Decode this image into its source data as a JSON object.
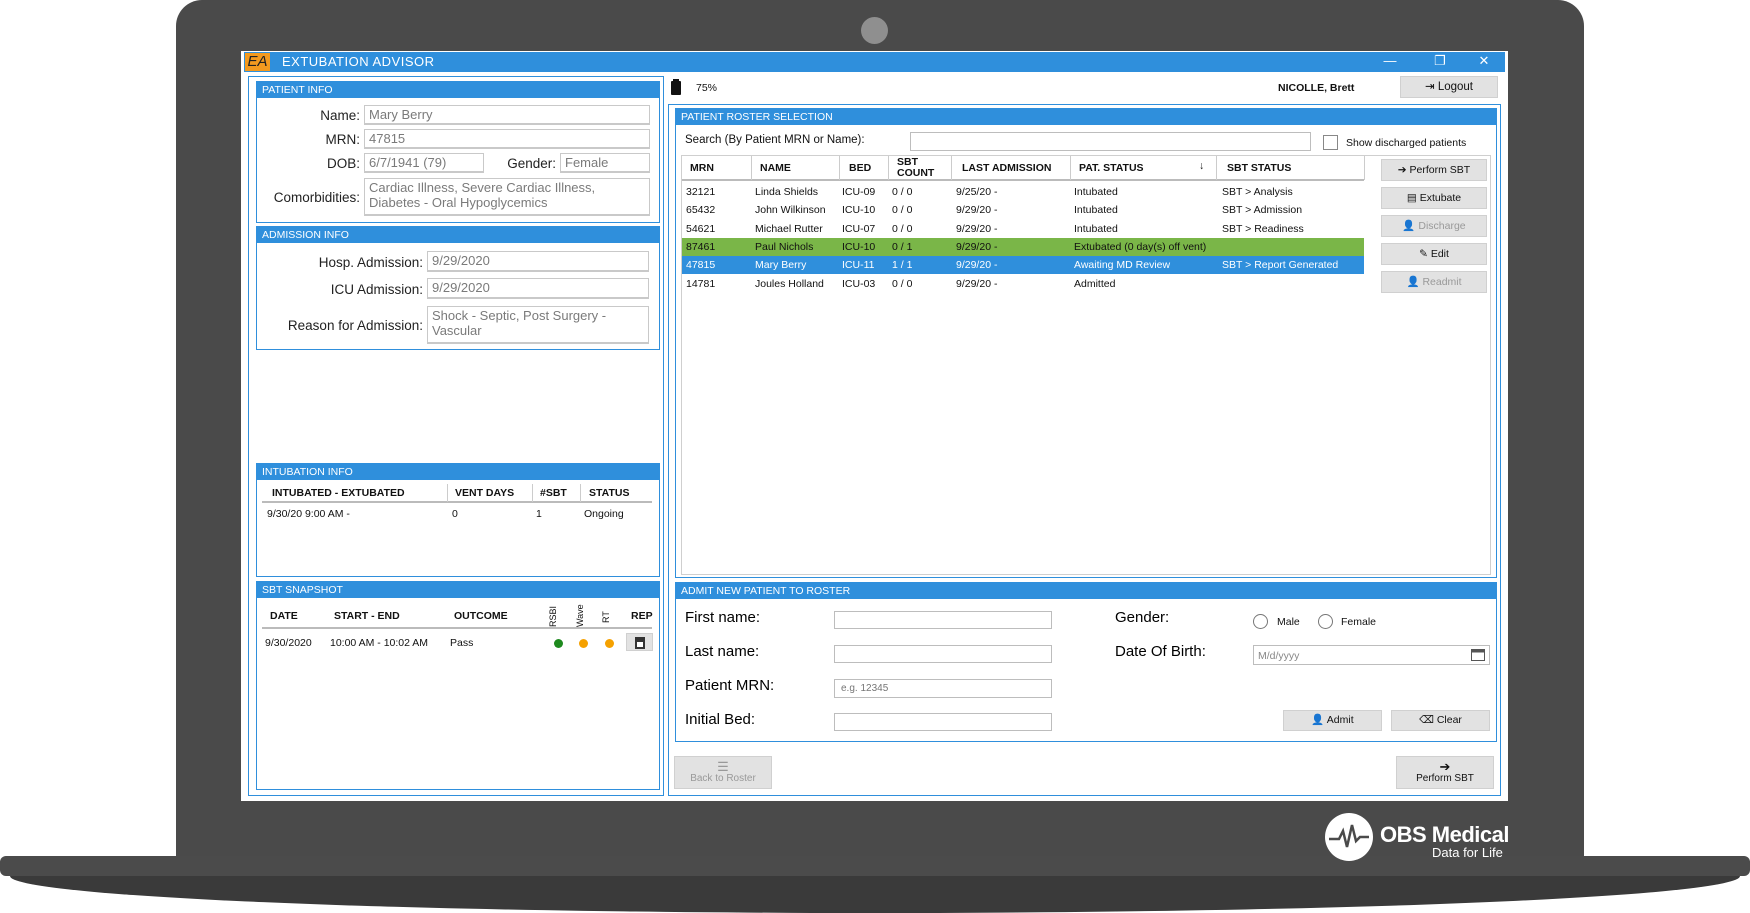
{
  "app": {
    "logo": "EA",
    "title": "EXTUBATION ADVISOR"
  },
  "window_controls": {
    "minimize": "—",
    "restore": "❐",
    "close": "✕"
  },
  "topbar": {
    "battery": "75%",
    "user": "NICOLLE, Brett",
    "logout": "Logout"
  },
  "patient_info": {
    "header": "PATIENT INFO",
    "name_label": "Name:",
    "name": "Mary Berry",
    "mrn_label": "MRN:",
    "mrn": "47815",
    "dob_label": "DOB:",
    "dob": "6/7/1941 (79)",
    "gender_label": "Gender:",
    "gender": "Female",
    "comorbidities_label": "Comorbidities:",
    "comorbidities": "Cardiac Illness, Severe Cardiac Illness, Diabetes - Oral Hypoglycemics"
  },
  "admission_info": {
    "header": "ADMISSION INFO",
    "hosp_label": "Hosp. Admission:",
    "hosp": "9/29/2020",
    "icu_label": "ICU Admission:",
    "icu": "9/29/2020",
    "reason_label": "Reason for Admission:",
    "reason": "Shock - Septic, Post Surgery - Vascular"
  },
  "intubation_info": {
    "header": "INTUBATION INFO",
    "columns": [
      "INTUBATED - EXTUBATED",
      "VENT DAYS",
      "#SBT",
      "STATUS"
    ],
    "rows": [
      {
        "period": "9/30/20 9:00 AM -",
        "vent_days": "0",
        "sbt": "1",
        "status": "Ongoing"
      }
    ]
  },
  "sbt_snapshot": {
    "header": "SBT SNAPSHOT",
    "columns": [
      "DATE",
      "START - END",
      "OUTCOME",
      "RSBI",
      "Wave",
      "RT",
      "REPORT"
    ],
    "rows": [
      {
        "date": "9/30/2020",
        "time": "10:00 AM - 10:02 AM",
        "outcome": "Pass"
      }
    ],
    "dot_colors": [
      "#1e8a1e",
      "#f5a100",
      "#f5a100"
    ]
  },
  "roster": {
    "header": "PATIENT ROSTER SELECTION",
    "search_label": "Search (By Patient MRN or Name):",
    "show_discharged": "Show discharged patients",
    "columns": [
      "MRN",
      "NAME",
      "BED",
      "SBT COUNT",
      "LAST ADMISSION",
      "PAT. STATUS",
      "SBT STATUS"
    ],
    "rows": [
      {
        "mrn": "32121",
        "name": "Linda Shields",
        "bed": "ICU-09",
        "sbt": "0 / 0",
        "admission": "9/25/20 -",
        "status": "Intubated",
        "sbt_status": "SBT > Analysis"
      },
      {
        "mrn": "65432",
        "name": "John Wilkinson",
        "bed": "ICU-10",
        "sbt": "0 / 0",
        "admission": "9/29/20 -",
        "status": "Intubated",
        "sbt_status": "SBT > Admission"
      },
      {
        "mrn": "54621",
        "name": "Michael Rutter",
        "bed": "ICU-07",
        "sbt": "0 / 0",
        "admission": "9/29/20 -",
        "status": "Intubated",
        "sbt_status": "SBT > Readiness"
      },
      {
        "mrn": "87461",
        "name": "Paul Nichols",
        "bed": "ICU-10",
        "sbt": "0 / 1",
        "admission": "9/29/20 -",
        "status": "Extubated (0 day(s) off vent)",
        "sbt_status": ""
      },
      {
        "mrn": "47815",
        "name": "Mary Berry",
        "bed": "ICU-11",
        "sbt": "1 / 1",
        "admission": "9/29/20 -",
        "status": "Awaiting MD Review",
        "sbt_status": "SBT > Report Generated"
      },
      {
        "mrn": "14781",
        "name": "Joules Holland",
        "bed": "ICU-03",
        "sbt": "0 / 0",
        "admission": "9/29/20 -",
        "status": "Admitted",
        "sbt_status": ""
      }
    ],
    "row_colors": {
      "extubated": "#7ab648",
      "selected": "#2f8fdc"
    },
    "actions": [
      "Perform SBT",
      "Extubate",
      "Discharge",
      "Edit",
      "Readmit"
    ]
  },
  "admit": {
    "header": "ADMIT NEW PATIENT TO ROSTER",
    "first_label": "First name:",
    "last_label": "Last name:",
    "mrn_label": "Patient MRN:",
    "mrn_placeholder": "e.g. 12345",
    "bed_label": "Initial Bed:",
    "gender_label": "Gender:",
    "male": "Male",
    "female": "Female",
    "dob_label": "Date Of Birth:",
    "dob_placeholder": "M/d/yyyy",
    "admit_btn": "Admit",
    "clear_btn": "Clear"
  },
  "footer": {
    "back": "Back to Roster",
    "perform": "Perform SBT"
  },
  "brand": {
    "name": "OBS Medical",
    "tagline": "Data for Life"
  }
}
